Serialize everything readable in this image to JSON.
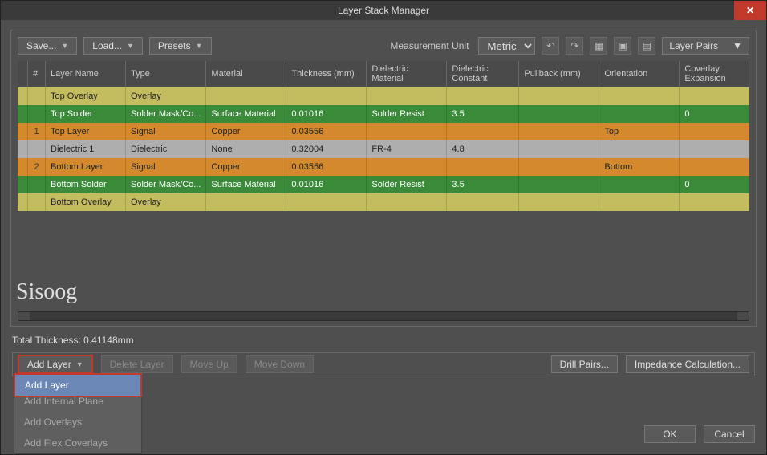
{
  "title": "Layer Stack Manager",
  "close_glyph": "✕",
  "toolbar": {
    "save": "Save...",
    "load": "Load...",
    "presets": "Presets",
    "measurement_label": "Measurement Unit",
    "measurement_value": "Metric",
    "layer_pairs": "Layer Pairs"
  },
  "columns": {
    "idx": "#",
    "layer_name": "Layer Name",
    "type": "Type",
    "material": "Material",
    "thickness": "Thickness (mm)",
    "dielectric_material": "Dielectric Material",
    "dielectric_constant": "Dielectric Constant",
    "pullback": "Pullback (mm)",
    "orientation": "Orientation",
    "coverlay": "Coverlay Expansion"
  },
  "rows": [
    {
      "cls": "row-yellow",
      "idx": "",
      "name": "Top Overlay",
      "type": "Overlay",
      "material": "",
      "thickness": "",
      "dmat": "",
      "dconst": "",
      "pullback": "",
      "orient": "",
      "cover": ""
    },
    {
      "cls": "row-green",
      "idx": "",
      "name": "Top Solder",
      "type": "Solder Mask/Co...",
      "material": "Surface Material",
      "thickness": "0.01016",
      "dmat": "Solder Resist",
      "dconst": "3.5",
      "pullback": "",
      "orient": "",
      "cover": "0"
    },
    {
      "cls": "row-orange",
      "idx": "1",
      "name": "Top Layer",
      "type": "Signal",
      "material": "Copper",
      "thickness": "0.03556",
      "dmat": "",
      "dconst": "",
      "pullback": "",
      "orient": "Top",
      "cover": ""
    },
    {
      "cls": "row-gray",
      "idx": "",
      "name": "Dielectric 1",
      "type": "Dielectric",
      "material": "None",
      "thickness": "0.32004",
      "dmat": "FR-4",
      "dconst": "4.8",
      "pullback": "",
      "orient": "",
      "cover": ""
    },
    {
      "cls": "row-orange",
      "idx": "2",
      "name": "Bottom Layer",
      "type": "Signal",
      "material": "Copper",
      "thickness": "0.03556",
      "dmat": "",
      "dconst": "",
      "pullback": "",
      "orient": "Bottom",
      "cover": ""
    },
    {
      "cls": "row-green",
      "idx": "",
      "name": "Bottom Solder",
      "type": "Solder Mask/Co...",
      "material": "Surface Material",
      "thickness": "0.01016",
      "dmat": "Solder Resist",
      "dconst": "3.5",
      "pullback": "",
      "orient": "",
      "cover": "0"
    },
    {
      "cls": "row-yellow",
      "idx": "",
      "name": "Bottom Overlay",
      "type": "Overlay",
      "material": "",
      "thickness": "",
      "dmat": "",
      "dconst": "",
      "pullback": "",
      "orient": "",
      "cover": ""
    }
  ],
  "watermark": "Sisoog",
  "total_thickness": "Total Thickness: 0.41148mm",
  "actions": {
    "add_layer": "Add Layer",
    "delete_layer": "Delete Layer",
    "move_up": "Move Up",
    "move_down": "Move Down",
    "drill_pairs": "Drill Pairs...",
    "impedance": "Impedance Calculation..."
  },
  "menu": {
    "add_layer": "Add Layer",
    "add_internal_plane": "Add Internal Plane",
    "add_overlays": "Add Overlays",
    "add_flex_coverlays": "Add Flex Coverlays"
  },
  "buttons": {
    "ok": "OK",
    "cancel": "Cancel"
  }
}
